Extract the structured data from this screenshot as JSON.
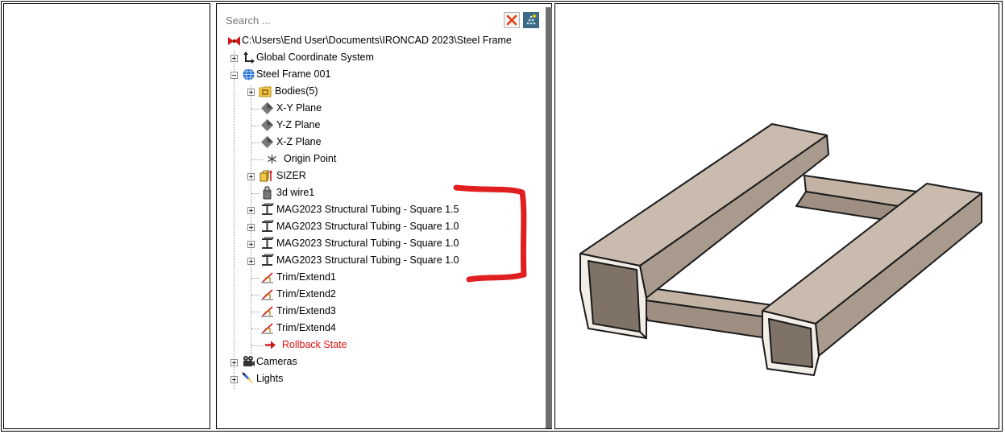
{
  "search": {
    "placeholder": "Search ..."
  },
  "tree": {
    "root_path": "C:\\Users\\End User\\Documents\\IRONCAD 2023\\Steel Frame",
    "global_cs": "Global Coordinate System",
    "part": "Steel Frame 001",
    "bodies": "Bodies(5)",
    "xy_plane": "X-Y Plane",
    "yz_plane": "Y-Z Plane",
    "xz_plane": "X-Z Plane",
    "origin": "Origin Point",
    "sizer": "SIZER",
    "wire": "3d wire1",
    "tubing": [
      "MAG2023 Structural Tubing - Square 1.5",
      "MAG2023 Structural Tubing - Square 1.0",
      "MAG2023 Structural Tubing - Square 1.0",
      "MAG2023 Structural Tubing - Square 1.0"
    ],
    "trims": [
      "Trim/Extend1",
      "Trim/Extend2",
      "Trim/Extend3",
      "Trim/Extend4"
    ],
    "rollback": "Rollback State",
    "cameras": "Cameras",
    "lights": "Lights"
  },
  "colors": {
    "rollback": "#e01010",
    "annotation": "#e02020",
    "tube_face": "#b3a395"
  }
}
